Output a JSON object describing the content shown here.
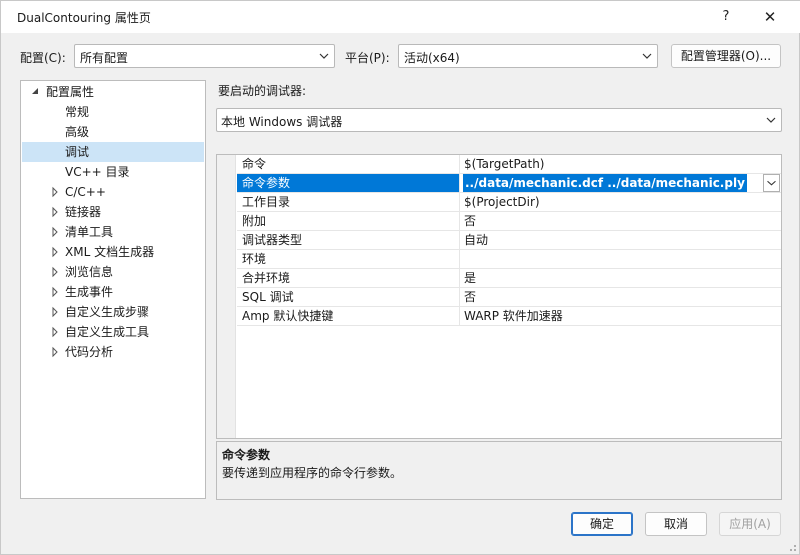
{
  "window": {
    "title": "DualContouring 属性页",
    "help_label": "?",
    "close_label": "✕"
  },
  "config_bar": {
    "config_label": "配置(C):",
    "config_value": "所有配置",
    "platform_label": "平台(P):",
    "platform_value": "活动(x64)",
    "manager_button": "配置管理器(O)..."
  },
  "tree": {
    "items": [
      {
        "label": "配置属性",
        "level": 0,
        "expander": "open"
      },
      {
        "label": "常规",
        "level": 1,
        "expander": "none"
      },
      {
        "label": "高级",
        "level": 1,
        "expander": "none"
      },
      {
        "label": "调试",
        "level": 1,
        "expander": "none",
        "selected": true
      },
      {
        "label": "VC++ 目录",
        "level": 1,
        "expander": "none"
      },
      {
        "label": "C/C++",
        "level": 1,
        "expander": "closed"
      },
      {
        "label": "链接器",
        "level": 1,
        "expander": "closed"
      },
      {
        "label": "清单工具",
        "level": 1,
        "expander": "closed"
      },
      {
        "label": "XML 文档生成器",
        "level": 1,
        "expander": "closed"
      },
      {
        "label": "浏览信息",
        "level": 1,
        "expander": "closed"
      },
      {
        "label": "生成事件",
        "level": 1,
        "expander": "closed"
      },
      {
        "label": "自定义生成步骤",
        "level": 1,
        "expander": "closed"
      },
      {
        "label": "自定义生成工具",
        "level": 1,
        "expander": "closed"
      },
      {
        "label": "代码分析",
        "level": 1,
        "expander": "closed"
      }
    ]
  },
  "debugger": {
    "label": "要启动的调试器:",
    "value": "本地 Windows 调试器"
  },
  "properties": {
    "rows": [
      {
        "name": "命令",
        "value": "$(TargetPath)"
      },
      {
        "name": "命令参数",
        "value": "../data/mechanic.dcf  ../data/mechanic.ply",
        "selected": true
      },
      {
        "name": "工作目录",
        "value": "$(ProjectDir)"
      },
      {
        "name": "附加",
        "value": "否"
      },
      {
        "name": "调试器类型",
        "value": "自动"
      },
      {
        "name": "环境",
        "value": ""
      },
      {
        "name": "合并环境",
        "value": "是"
      },
      {
        "name": "SQL 调试",
        "value": "否"
      },
      {
        "name": "Amp 默认快捷键",
        "value": "WARP 软件加速器"
      }
    ]
  },
  "description": {
    "title": "命令参数",
    "text": "要传递到应用程序的命令行参数。"
  },
  "buttons": {
    "ok": "确定",
    "cancel": "取消",
    "apply": "应用(A)"
  },
  "colors": {
    "selection": "#0078d7",
    "tree_selection": "#cce4f7",
    "primary_border": "#2b74c8"
  }
}
